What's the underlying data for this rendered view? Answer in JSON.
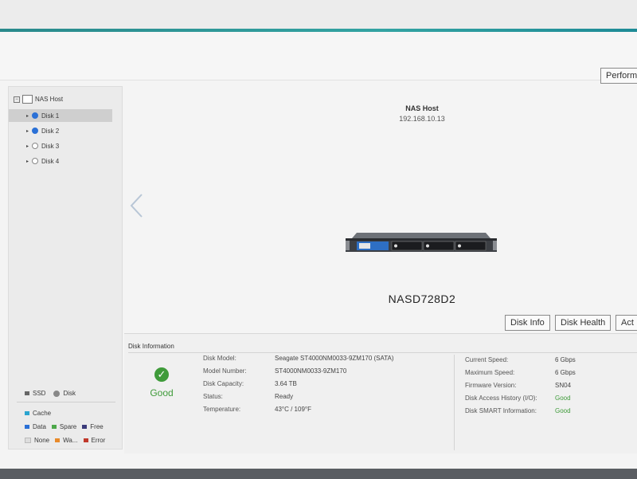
{
  "header": {
    "perform_button": "Perform"
  },
  "tree": {
    "root": "NAS Host",
    "items": [
      {
        "label": "Disk 1",
        "selected": true,
        "active": true
      },
      {
        "label": "Disk 2",
        "selected": false,
        "active": true
      },
      {
        "label": "Disk 3",
        "selected": false,
        "active": false
      },
      {
        "label": "Disk 4",
        "selected": false,
        "active": false
      }
    ]
  },
  "legend": {
    "ssd": "SSD",
    "disk": "Disk",
    "cache": "Cache",
    "data": "Data",
    "spare": "Spare",
    "free": "Free",
    "none": "None",
    "warning": "Wa...",
    "error": "Error",
    "colors": {
      "ssd": "#666666",
      "disk": "#888888",
      "cache": "#2aa4cf",
      "data": "#2b70d6",
      "spare": "#4da84a",
      "free": "#3b3b7a",
      "none": "#cccccc",
      "warning": "#e88a2a",
      "error": "#c0392b"
    }
  },
  "host": {
    "title": "NAS Host",
    "ip": "192.168.10.13",
    "model": "NASD728D2"
  },
  "actions": {
    "disk_info": "Disk Info",
    "disk_health": "Disk Health",
    "action": "Act"
  },
  "disk_information": {
    "title": "Disk Information",
    "status_text": "Good",
    "left": [
      {
        "label": "Disk Model:",
        "value": "Seagate ST4000NM0033-9ZM170 (SATA)"
      },
      {
        "label": "Model Number:",
        "value": "ST4000NM0033-9ZM170"
      },
      {
        "label": "Disk Capacity:",
        "value": "3.64 TB"
      },
      {
        "label": "Status:",
        "value": "Ready"
      },
      {
        "label": "Temperature:",
        "value": "43°C / 109°F"
      }
    ],
    "right": [
      {
        "label": "Current Speed:",
        "value": "6 Gbps"
      },
      {
        "label": "Maximum Speed:",
        "value": "6 Gbps"
      },
      {
        "label": "Firmware Version:",
        "value": "SN04"
      },
      {
        "label": "Disk Access History (I/O):",
        "value": "Good"
      },
      {
        "label": "Disk SMART Information:",
        "value": "Good"
      }
    ]
  },
  "colors": {
    "accent": "#2a8a8c",
    "good": "#3f9b3a",
    "selected_disk": "#2b70d6"
  }
}
